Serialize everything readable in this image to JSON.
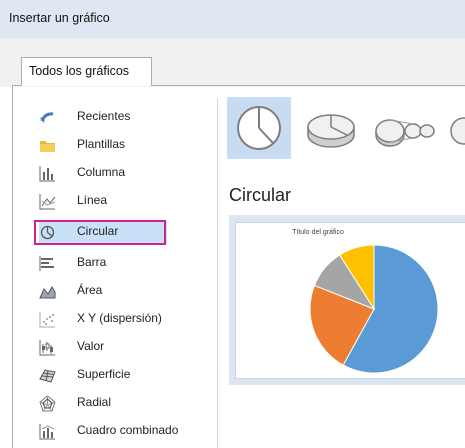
{
  "window": {
    "title": "Insertar un gráfico"
  },
  "tab": {
    "label": "Todos los gráficos"
  },
  "sidebar": {
    "items": [
      {
        "label": "Recientes",
        "icon": "recent-icon"
      },
      {
        "label": "Plantillas",
        "icon": "folder-icon"
      },
      {
        "label": "Columna",
        "icon": "column-chart-icon"
      },
      {
        "label": "Línea",
        "icon": "line-chart-icon"
      },
      {
        "label": "Circular",
        "icon": "pie-chart-icon",
        "selected": true
      },
      {
        "label": "Barra",
        "icon": "bar-chart-icon"
      },
      {
        "label": "Área",
        "icon": "area-chart-icon"
      },
      {
        "label": "X Y (dispersión)",
        "icon": "scatter-chart-icon"
      },
      {
        "label": "Valor",
        "icon": "stock-chart-icon"
      },
      {
        "label": "Superficie",
        "icon": "surface-chart-icon"
      },
      {
        "label": "Radial",
        "icon": "radar-chart-icon"
      },
      {
        "label": "Cuadro combinado",
        "icon": "combo-chart-icon"
      }
    ]
  },
  "main": {
    "heading": "Circular",
    "subtypes": [
      "pie-2d",
      "pie-3d",
      "pie-of-pie",
      "bar-of-pie"
    ],
    "preview": {
      "chart_title": "Título del gráfico"
    }
  },
  "chart_data": {
    "type": "pie",
    "title": "Título del gráfico",
    "values": [
      58,
      23,
      10,
      9
    ],
    "colors": [
      "#5b9bd5",
      "#ed7d31",
      "#a5a5a5",
      "#ffc000"
    ]
  },
  "colors": {
    "selection_fill": "#c9e1f7",
    "highlight_border": "#d1238c"
  }
}
